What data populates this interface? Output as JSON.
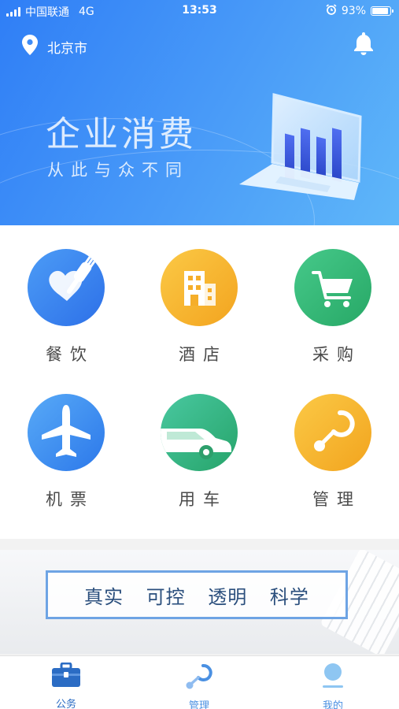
{
  "status_bar": {
    "carrier": "中国联通",
    "network": "4G",
    "time": "13:53",
    "battery": "93%",
    "battery_level": 0.93
  },
  "header": {
    "location": "北京市"
  },
  "hero": {
    "title": "企业消费",
    "subtitle": "从此与众不同"
  },
  "services": [
    {
      "label": "餐饮",
      "icon": "dining-icon"
    },
    {
      "label": "酒店",
      "icon": "hotel-icon"
    },
    {
      "label": "采购",
      "icon": "shopping-cart-icon"
    },
    {
      "label": "机票",
      "icon": "airplane-icon"
    },
    {
      "label": "用车",
      "icon": "car-icon"
    },
    {
      "label": "管理",
      "icon": "management-icon"
    }
  ],
  "banner": {
    "slogan": "真实 可控 透明 科学"
  },
  "tabbar": {
    "items": [
      {
        "label": "公务",
        "icon": "briefcase-icon",
        "active": true
      },
      {
        "label": "管理",
        "icon": "management-icon",
        "active": false
      },
      {
        "label": "我的",
        "icon": "profile-icon",
        "active": false
      }
    ]
  },
  "colors": {
    "accent": "#2f7ef6",
    "dining": "#3a86f0",
    "hotel": "#f7b62b",
    "shopping": "#31b46f",
    "flight": "#3a8ff0",
    "car": "#2fb27c",
    "management": "#f5b32b",
    "tab_active": "#2b6cc4",
    "tab_inactive": "#4a90e2"
  }
}
